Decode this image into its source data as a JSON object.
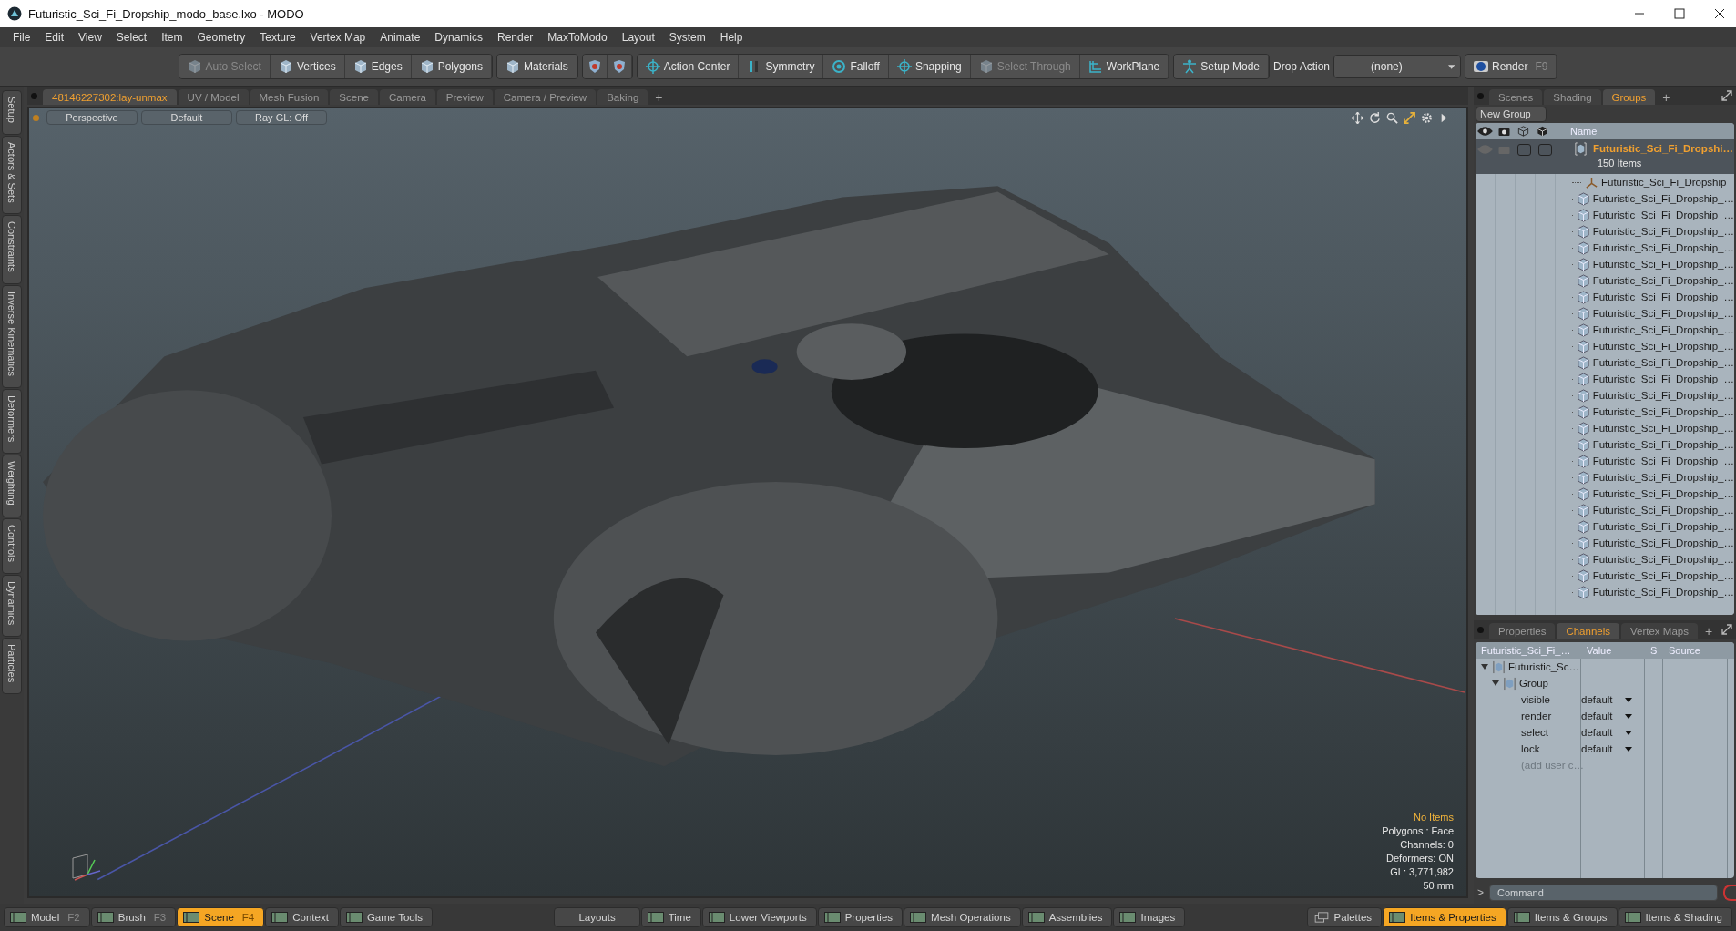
{
  "window": {
    "title": "Futuristic_Sci_Fi_Dropship_modo_base.lxo - MODO"
  },
  "menu": [
    "File",
    "Edit",
    "View",
    "Select",
    "Item",
    "Geometry",
    "Texture",
    "Vertex Map",
    "Animate",
    "Dynamics",
    "Render",
    "MaxToModo",
    "Layout",
    "System",
    "Help"
  ],
  "toolbar": [
    [
      {
        "kind": "tool",
        "label": "Auto Select",
        "disabled": true
      },
      {
        "kind": "tool",
        "label": "Vertices",
        "disabled": false
      },
      {
        "kind": "tool",
        "label": "Edges",
        "disabled": false
      },
      {
        "kind": "tool",
        "label": "Polygons",
        "disabled": false
      }
    ],
    [
      {
        "kind": "tool",
        "label": "Materials",
        "disabled": false
      }
    ],
    [
      {
        "kind": "icon",
        "disabled": false
      },
      {
        "kind": "icon",
        "disabled": false
      }
    ],
    [
      {
        "kind": "tool",
        "label": "Action Center",
        "disabled": false
      },
      {
        "kind": "tool",
        "label": "Symmetry",
        "disabled": false
      },
      {
        "kind": "tool",
        "label": "Falloff",
        "disabled": false
      },
      {
        "kind": "tool",
        "label": "Snapping",
        "disabled": false
      },
      {
        "kind": "tool",
        "label": "Select Through",
        "disabled": true
      },
      {
        "kind": "tool",
        "label": "WorkPlane",
        "disabled": false
      }
    ],
    [
      {
        "kind": "tool",
        "label": "Setup Mode",
        "disabled": false
      }
    ],
    [
      {
        "kind": "label",
        "label": "Drop Action"
      },
      {
        "kind": "dropdown",
        "label": "(none)"
      }
    ],
    [
      {
        "kind": "tool",
        "label": "Render",
        "key": "F9",
        "disabled": false
      }
    ]
  ],
  "left_tabs": [
    "Setup",
    "Actors & Sets",
    "Constraints",
    "Inverse Kinematics",
    "Deformers",
    "Weighting",
    "Controls",
    "Dynamics",
    "Particles"
  ],
  "viewport": {
    "tabs": [
      {
        "label": "48146227302:lay-unmax",
        "selected": true
      },
      {
        "label": "UV / Model",
        "selected": false
      },
      {
        "label": "Mesh Fusion",
        "selected": false
      },
      {
        "label": "Scene",
        "selected": false
      },
      {
        "label": "Camera",
        "selected": false
      },
      {
        "label": "Preview",
        "selected": false
      },
      {
        "label": "Camera / Preview",
        "selected": false
      },
      {
        "label": "Baking",
        "selected": false
      }
    ],
    "add_tab": "+",
    "header_buttons": [
      "Perspective",
      "Default",
      "Ray GL: Off"
    ],
    "info": [
      {
        "text": "No Items",
        "kind": "highlight"
      },
      {
        "text": "Polygons : Face",
        "kind": "plain"
      },
      {
        "text": "Channels: 0",
        "kind": "plain"
      },
      {
        "text": "Deformers: ON",
        "kind": "plain"
      },
      {
        "text": "GL: 3,771,982",
        "kind": "plain"
      },
      {
        "text": "50 mm",
        "kind": "plain"
      }
    ]
  },
  "groups_panel": {
    "tabs": [
      {
        "label": "Scenes",
        "selected": false
      },
      {
        "label": "Shading",
        "selected": false
      },
      {
        "label": "Groups",
        "selected": true
      }
    ],
    "add_tab": "+",
    "new_group_button": "New Group",
    "name_column": "Name",
    "group": {
      "name": "Futuristic_Sci_Fi_Dropshi…",
      "count": "150 Items",
      "lock_checked": false,
      "select_checked": false,
      "children": [
        {
          "name": "Futuristic_Sci_Fi_Dropship",
          "kind": "locator"
        },
        {
          "name": "Futuristic_Sci_Fi_Dropship_…",
          "kind": "mesh"
        },
        {
          "name": "Futuristic_Sci_Fi_Dropship_…",
          "kind": "mesh"
        },
        {
          "name": "Futuristic_Sci_Fi_Dropship_…",
          "kind": "mesh"
        },
        {
          "name": "Futuristic_Sci_Fi_Dropship_…",
          "kind": "mesh"
        },
        {
          "name": "Futuristic_Sci_Fi_Dropship_…",
          "kind": "mesh"
        },
        {
          "name": "Futuristic_Sci_Fi_Dropship_…",
          "kind": "mesh"
        },
        {
          "name": "Futuristic_Sci_Fi_Dropship_…",
          "kind": "mesh"
        },
        {
          "name": "Futuristic_Sci_Fi_Dropship_…",
          "kind": "mesh"
        },
        {
          "name": "Futuristic_Sci_Fi_Dropship_…",
          "kind": "mesh"
        },
        {
          "name": "Futuristic_Sci_Fi_Dropship_…",
          "kind": "mesh"
        },
        {
          "name": "Futuristic_Sci_Fi_Dropship_…",
          "kind": "mesh"
        },
        {
          "name": "Futuristic_Sci_Fi_Dropship_…",
          "kind": "mesh"
        },
        {
          "name": "Futuristic_Sci_Fi_Dropship_…",
          "kind": "mesh"
        },
        {
          "name": "Futuristic_Sci_Fi_Dropship_…",
          "kind": "mesh"
        },
        {
          "name": "Futuristic_Sci_Fi_Dropship_…",
          "kind": "mesh"
        },
        {
          "name": "Futuristic_Sci_Fi_Dropship_…",
          "kind": "mesh"
        },
        {
          "name": "Futuristic_Sci_Fi_Dropship_…",
          "kind": "mesh"
        },
        {
          "name": "Futuristic_Sci_Fi_Dropship_…",
          "kind": "mesh"
        },
        {
          "name": "Futuristic_Sci_Fi_Dropship_…",
          "kind": "mesh"
        },
        {
          "name": "Futuristic_Sci_Fi_Dropship_…",
          "kind": "mesh"
        },
        {
          "name": "Futuristic_Sci_Fi_Dropship_…",
          "kind": "mesh"
        },
        {
          "name": "Futuristic_Sci_Fi_Dropship_…",
          "kind": "mesh"
        },
        {
          "name": "Futuristic_Sci_Fi_Dropship_…",
          "kind": "mesh"
        },
        {
          "name": "Futuristic_Sci_Fi_Dropship_…",
          "kind": "mesh"
        },
        {
          "name": "Futuristic_Sci_Fi_Dropship_…",
          "kind": "mesh"
        }
      ]
    }
  },
  "channels_panel": {
    "tabs": [
      {
        "label": "Properties",
        "selected": false
      },
      {
        "label": "Channels",
        "selected": true
      },
      {
        "label": "Vertex Maps",
        "selected": false
      }
    ],
    "add_tab": "+",
    "columns": [
      "Futuristic_Sci_Fi_…",
      "Value",
      "S",
      "Source"
    ],
    "tree": {
      "name": "Futuristic_Sc…",
      "expanded": true,
      "children": [
        {
          "name": "Group",
          "expanded": true,
          "children": [
            {
              "name": "visible",
              "value": "default",
              "kind": "channel"
            },
            {
              "name": "render",
              "value": "default",
              "kind": "channel"
            },
            {
              "name": "select",
              "value": "default",
              "kind": "channel"
            },
            {
              "name": "lock",
              "value": "default",
              "kind": "channel"
            },
            {
              "name": "(add user c…",
              "kind": "add"
            }
          ]
        }
      ]
    },
    "command": {
      "prompt": ">",
      "placeholder": "Command"
    }
  },
  "bottom_bar": {
    "left": [
      {
        "label": "Model",
        "key": "F2",
        "selected": false,
        "kind": "layout"
      },
      {
        "label": "Brush",
        "key": "F3",
        "selected": false,
        "kind": "layout"
      },
      {
        "label": "Scene",
        "key": "F4",
        "selected": true,
        "kind": "layout"
      },
      {
        "label": "Context",
        "selected": false,
        "kind": "layout"
      },
      {
        "label": "Game Tools",
        "selected": false,
        "kind": "layout"
      }
    ],
    "center": [
      {
        "label": "Layouts",
        "selected": false,
        "kind": "plain"
      },
      {
        "label": "Time",
        "selected": false,
        "kind": "layout"
      },
      {
        "label": "Lower Viewports",
        "selected": false,
        "kind": "layout"
      },
      {
        "label": "Properties",
        "selected": false,
        "kind": "layout"
      },
      {
        "label": "Mesh Operations",
        "selected": false,
        "kind": "layout"
      },
      {
        "label": "Assemblies",
        "selected": false,
        "kind": "layout"
      },
      {
        "label": "Images",
        "selected": false,
        "kind": "layout"
      }
    ],
    "right": [
      {
        "label": "Palettes",
        "selected": false,
        "kind": "palette"
      },
      {
        "label": "Items & Properties",
        "selected": true,
        "kind": "layout"
      },
      {
        "label": "Items & Groups",
        "selected": false,
        "kind": "layout"
      },
      {
        "label": "Items & Shading",
        "selected": false,
        "kind": "layout"
      }
    ]
  }
}
